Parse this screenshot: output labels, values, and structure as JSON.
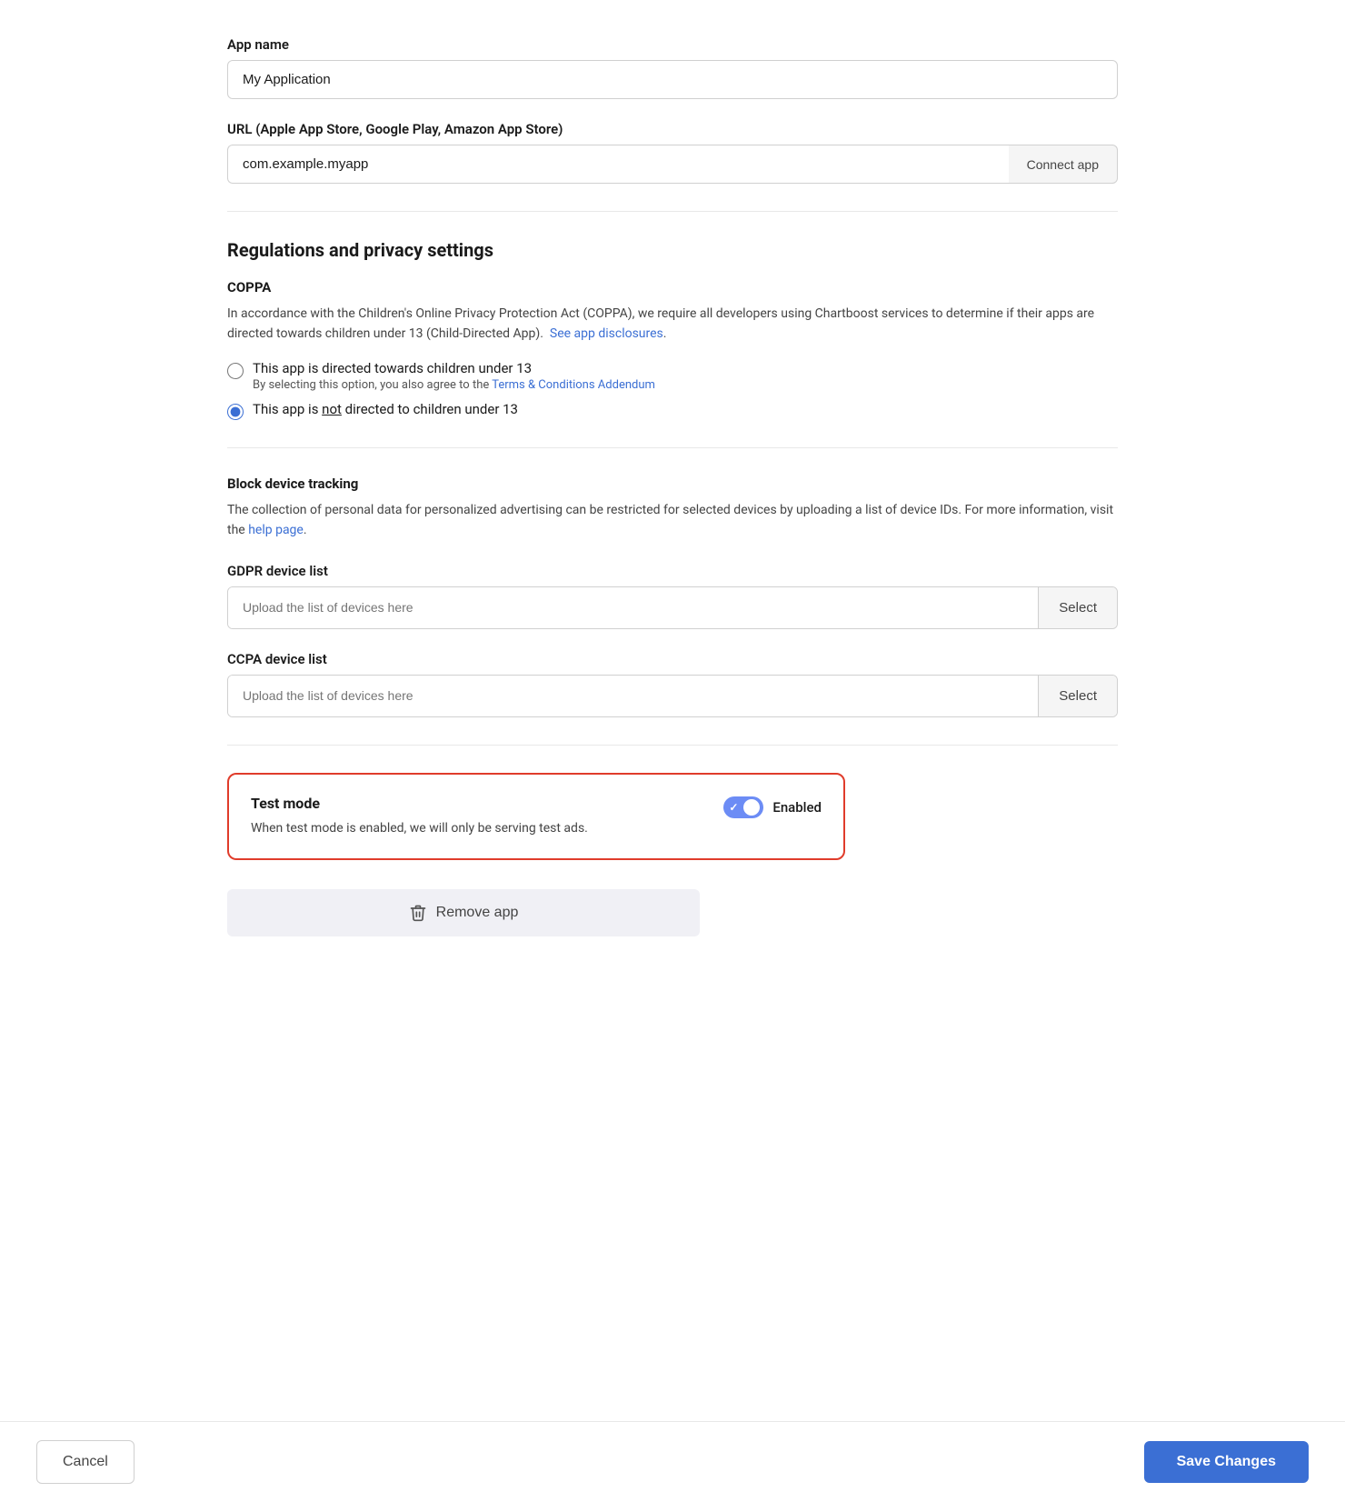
{
  "appName": {
    "label": "App name",
    "value": "My Application",
    "placeholder": "My Application"
  },
  "url": {
    "label": "URL (Apple App Store, Google Play, Amazon App Store)",
    "value": "com.example.myapp",
    "placeholder": "com.example.myapp",
    "connectButton": "Connect app"
  },
  "regulations": {
    "sectionTitle": "Regulations and privacy settings",
    "coppa": {
      "title": "COPPA",
      "description": "In accordance with the Children's Online Privacy Protection Act (COPPA), we require all developers using Chartboost services to determine if their apps are directed towards children under 13 (Child-Directed App).",
      "seeDisclosuresLink": "See app disclosures",
      "radio1": {
        "label": "This app is directed towards children under 13",
        "sublabel": "By selecting this option, you also agree to the",
        "termsLink": "Terms & Conditions Addendum",
        "checked": false
      },
      "radio2": {
        "label_pre": "This app is ",
        "label_underline": "not",
        "label_post": " directed to children under 13",
        "checked": true
      }
    },
    "blockTracking": {
      "title": "Block device tracking",
      "description": "The collection of personal data for personalized advertising can be restricted for selected devices by uploading a list of device IDs. For more information, visit the",
      "helpLink": "help page"
    },
    "gdpr": {
      "label": "GDPR device list",
      "placeholder": "Upload the list of devices here",
      "selectButton": "Select"
    },
    "ccpa": {
      "label": "CCPA device list",
      "placeholder": "Upload the list of devices here",
      "selectButton": "Select"
    }
  },
  "testMode": {
    "title": "Test mode",
    "description": "When test mode is enabled, we will only be serving test ads.",
    "toggleLabel": "Enabled",
    "enabled": true
  },
  "removeApp": {
    "label": "Remove app"
  },
  "footer": {
    "cancelLabel": "Cancel",
    "saveLabel": "Save Changes"
  }
}
